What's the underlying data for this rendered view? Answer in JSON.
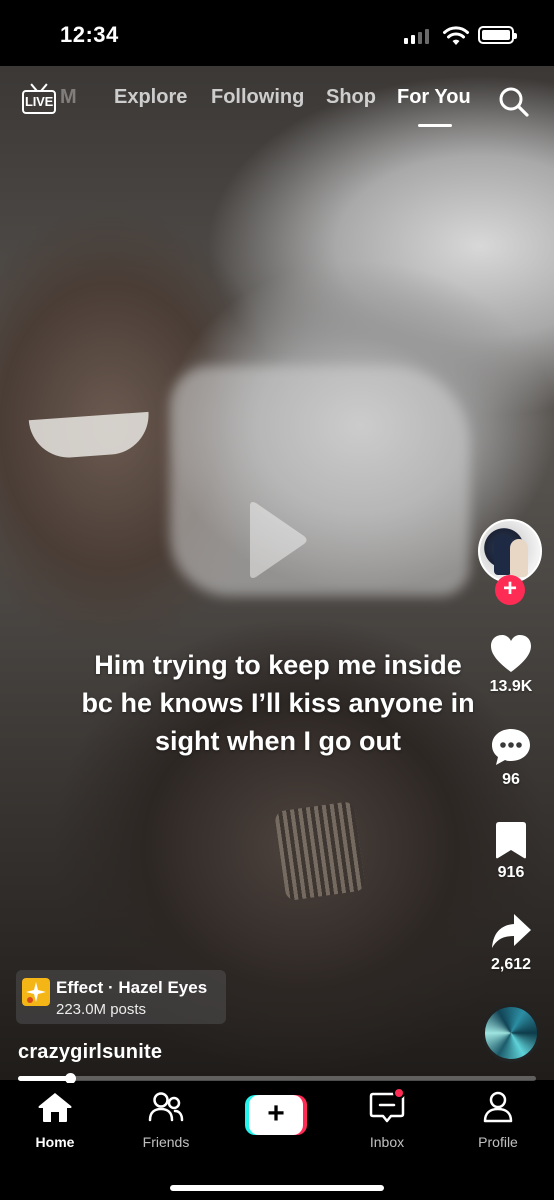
{
  "status_bar": {
    "time": "12:34",
    "signal_bars": 4,
    "signal_active": 2,
    "battery_level": 1.0
  },
  "top_nav": {
    "live_label": "LIVE",
    "faded_tab": "M",
    "tabs": [
      "Explore",
      "Following",
      "Shop",
      "For You"
    ],
    "active_tab": "For You",
    "search_icon": "search-icon"
  },
  "video": {
    "caption": "Him trying to keep me inside bc he knows I’ll kiss anyone in sight when I go out",
    "state": "paused",
    "progress": 0.1
  },
  "actions": {
    "follow_icon": "plus-icon",
    "likes": "13.9K",
    "comments": "96",
    "saves": "916",
    "shares": "2,612"
  },
  "effect": {
    "title": "Effect · Hazel Eyes",
    "posts": "223.0M posts"
  },
  "author": {
    "username": "crazygirlsunite"
  },
  "bottom_nav": {
    "home": "Home",
    "friends": "Friends",
    "create": "+",
    "inbox": "Inbox",
    "profile": "Profile",
    "active": "Home",
    "inbox_has_badge": true
  },
  "colors": {
    "accent_red": "#fe2c55",
    "accent_cyan": "#25f4ee",
    "effect_yellow": "#f4b516"
  }
}
